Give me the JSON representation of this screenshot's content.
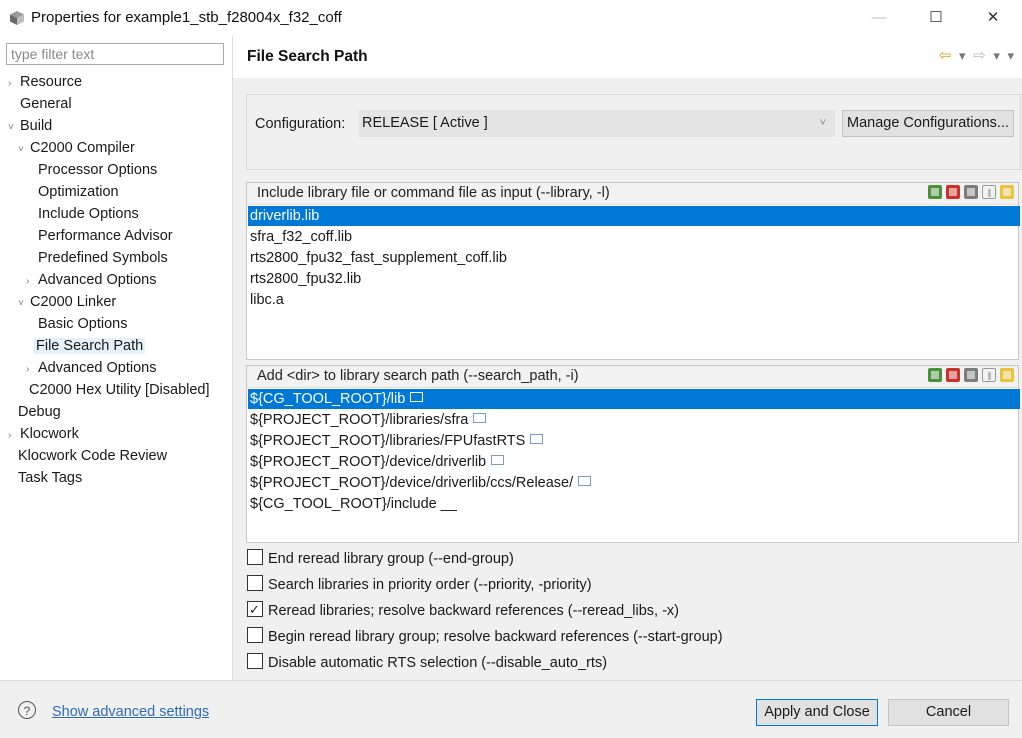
{
  "window": {
    "title": "Properties for example1_stb_f28004x_f32_coff",
    "min": "—",
    "max": "☐",
    "close": "✕"
  },
  "filter": {
    "placeholder": "type filter text"
  },
  "tree": [
    {
      "label": "Resource",
      "arrow": "›"
    },
    {
      "label": "General",
      "arrow": ""
    },
    {
      "label": "Build",
      "arrow": "˅"
    },
    {
      "label": "C2000 Compiler",
      "arrow": "˅"
    },
    {
      "label": "Processor Options",
      "arrow": ""
    },
    {
      "label": "Optimization",
      "arrow": ""
    },
    {
      "label": "Include Options",
      "arrow": ""
    },
    {
      "label": "Performance Advisor",
      "arrow": ""
    },
    {
      "label": "Predefined Symbols",
      "arrow": ""
    },
    {
      "label": "Advanced Options",
      "arrow": "›"
    },
    {
      "label": "C2000 Linker",
      "arrow": "˅"
    },
    {
      "label": "Basic Options",
      "arrow": ""
    },
    {
      "label": "File Search Path",
      "arrow": ""
    },
    {
      "label": "Advanced Options",
      "arrow": "›"
    },
    {
      "label": "C2000 Hex Utility  [Disabled]",
      "arrow": ""
    },
    {
      "label": "Debug",
      "arrow": ""
    },
    {
      "label": "Klocwork",
      "arrow": "›"
    },
    {
      "label": "Klocwork Code Review",
      "arrow": ""
    },
    {
      "label": "Task Tags",
      "arrow": ""
    }
  ],
  "page": {
    "title": "File Search Path"
  },
  "configuration": {
    "label": "Configuration:",
    "value": "RELEASE  [ Active ]",
    "manage_label": "Manage Configurations..."
  },
  "library_list": {
    "header": "Include library file or command file as input (--library, -l)",
    "items": [
      "driverlib.lib",
      "sfra_f32_coff.lib",
      "rts2800_fpu32_fast_supplement_coff.lib",
      "rts2800_fpu32.lib",
      "libc.a"
    ]
  },
  "search_path_list": {
    "header": "Add <dir> to library search path (--search_path, -i)",
    "items": [
      "${CG_TOOL_ROOT}/lib",
      "${PROJECT_ROOT}/libraries/sfra",
      "${PROJECT_ROOT}/libraries/FPUfastRTS",
      "${PROJECT_ROOT}/device/driverlib",
      "${PROJECT_ROOT}/device/driverlib/ccs/Release/",
      "${CG_TOOL_ROOT}/include __"
    ]
  },
  "checkboxes": [
    {
      "label": "End reread library group (--end-group)",
      "checked": false
    },
    {
      "label": "Search libraries in priority order (--priority, -priority)",
      "checked": false
    },
    {
      "label": "Reread libraries; resolve backward references (--reread_libs, -x)",
      "checked": true
    },
    {
      "label": "Begin reread library group; resolve backward references (--start-group)",
      "checked": false
    },
    {
      "label": "Disable automatic RTS selection (--disable_auto_rts)",
      "checked": false
    }
  ],
  "footer": {
    "help": "?",
    "advanced_link": "Show advanced settings",
    "apply_label": "Apply and Close",
    "cancel_label": "Cancel"
  }
}
